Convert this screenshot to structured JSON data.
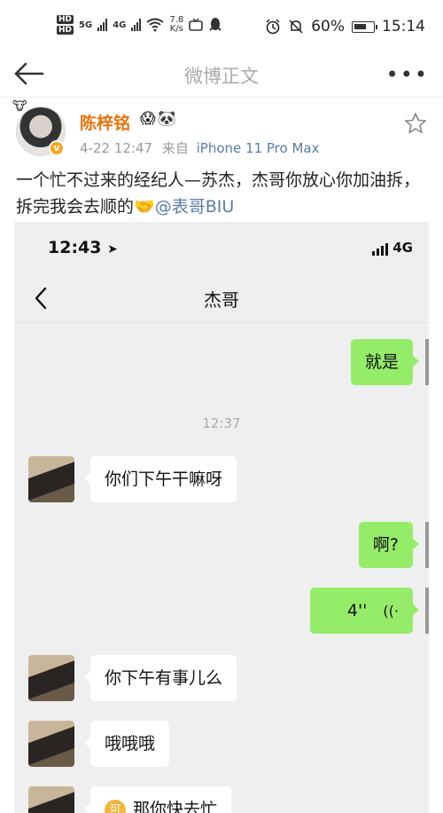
{
  "status_bar": {
    "hd1": "HD",
    "hd2": "HD",
    "net1": "5G",
    "net2": "4G",
    "speed_value": "7.8",
    "speed_unit": "K/s",
    "battery": "60%",
    "time": "15:14"
  },
  "nav": {
    "title": "微博正文",
    "more": "•••"
  },
  "post": {
    "username": "陈梓铭",
    "badge1": "😱",
    "badge2": "🐼",
    "verified": "v",
    "date": "4-22 12:47",
    "source_prefix": "来自",
    "device": "iPhone 11 Pro Max",
    "text_main": "一个忙不过来的经纪人—苏杰，杰哥你放心你加油拆，拆完我会去顺的",
    "handshake": "🤝",
    "mention": "@表哥BIU"
  },
  "screenshot": {
    "time": "12:43",
    "network": "4G",
    "chat_title": "杰哥",
    "timestamp": "12:37",
    "messages": [
      {
        "side": "me",
        "text": "就是"
      },
      {
        "side": "them",
        "text": "你们下午干嘛呀"
      },
      {
        "side": "me",
        "text": "啊?"
      },
      {
        "side": "me",
        "text": "4''",
        "voice": "((·"
      },
      {
        "side": "them",
        "text": "你下午有事儿么"
      },
      {
        "side": "them",
        "text": "哦哦哦"
      },
      {
        "side": "them",
        "text": "那你快去忙",
        "emoji": "可"
      }
    ]
  }
}
